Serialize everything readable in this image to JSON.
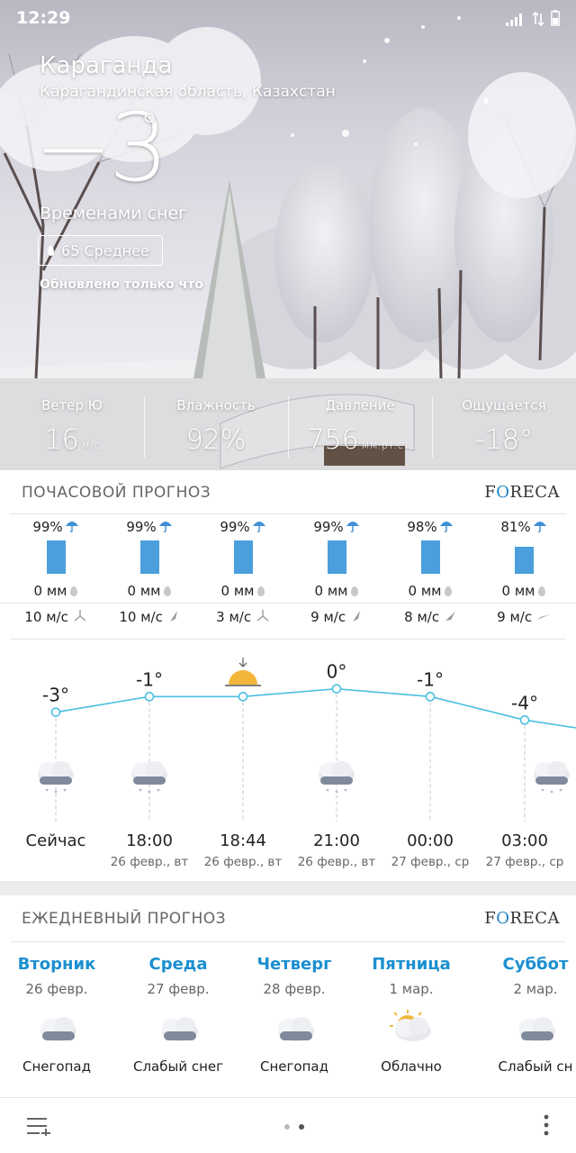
{
  "status": {
    "time": "12:29"
  },
  "location": {
    "city": "Караганда",
    "region": "Карагандинская область, Казахстан"
  },
  "current": {
    "temp": "−3",
    "degree": "°",
    "condition": "Временами снег",
    "aqi": "65 Среднее",
    "updated": "Обновлено только что"
  },
  "stats": [
    {
      "label": "Ветер Ю",
      "value": "16",
      "unit": "м/с"
    },
    {
      "label": "Влажность",
      "value": "92%",
      "unit": ""
    },
    {
      "label": "Давление",
      "value": "756",
      "unit": "мм.рт.ст."
    },
    {
      "label": "Ощущается",
      "value": "-18°",
      "unit": ""
    }
  ],
  "hourly": {
    "title": "ПОЧАСОВОЙ ПРОГНОЗ",
    "provider": {
      "pre": "F",
      "mid": "O",
      "post": "RECA"
    },
    "columns": [
      {
        "pct": "99%",
        "precip_fraction": 1.0,
        "mm": "0 мм",
        "wind": "10 м/с"
      },
      {
        "pct": "99%",
        "precip_fraction": 1.0,
        "mm": "0 мм",
        "wind": "10 м/с"
      },
      {
        "pct": "99%",
        "precip_fraction": 1.0,
        "mm": "0 мм",
        "wind": "3 м/с"
      },
      {
        "pct": "99%",
        "precip_fraction": 1.0,
        "mm": "0 мм",
        "wind": "9 м/с"
      },
      {
        "pct": "98%",
        "precip_fraction": 0.99,
        "mm": "0 мм",
        "wind": "8 м/с"
      },
      {
        "pct": "81%",
        "precip_fraction": 0.82,
        "mm": "0 мм",
        "wind": "9 м/с"
      }
    ],
    "points": [
      {
        "temp": "-3°",
        "value": -3,
        "time": "Сейчас",
        "date": "",
        "icon": "snow-cloud-icon"
      },
      {
        "temp": "-1°",
        "value": -1,
        "time": "18:00",
        "date": "26 февр., вт",
        "icon": "snow-cloud-icon"
      },
      {
        "temp": "",
        "value": -1,
        "time": "18:44",
        "date": "26 февр., вт",
        "icon": "sunset-icon"
      },
      {
        "temp": "0°",
        "value": 0,
        "time": "21:00",
        "date": "26 февр., вт",
        "icon": "snow-cloud-icon"
      },
      {
        "temp": "-1°",
        "value": -1,
        "time": "00:00",
        "date": "27 февр., ср",
        "icon": ""
      },
      {
        "temp": "-4°",
        "value": -4,
        "time": "03:00",
        "date": "27 февр., ср",
        "icon": "snow-cloud-icon"
      }
    ]
  },
  "daily": {
    "title": "ЕЖЕДНЕВНЫЙ ПРОГНОЗ",
    "provider": {
      "pre": "F",
      "mid": "O",
      "post": "RECA"
    },
    "days": [
      {
        "name": "Вторник",
        "date": "26 февр.",
        "cond": "Снегопад",
        "icon": "snow-cloud-icon"
      },
      {
        "name": "Среда",
        "date": "27 февр.",
        "cond": "Слабый снег",
        "icon": "light-snow-cloud-icon"
      },
      {
        "name": "Четверг",
        "date": "28 февр.",
        "cond": "Снегопад",
        "icon": "snow-cloud-icon"
      },
      {
        "name": "Пятница",
        "date": "1 мар.",
        "cond": "Облачно",
        "icon": "partly-cloudy-icon"
      },
      {
        "name": "Суббот",
        "date": "2 мар.",
        "cond": "Слабый сн",
        "icon": "light-snow-cloud-icon"
      }
    ]
  },
  "colors": {
    "accent": "#1b8fd0",
    "precip_bar": "#4a9fdc",
    "temp_line": "#4bbfe0"
  }
}
